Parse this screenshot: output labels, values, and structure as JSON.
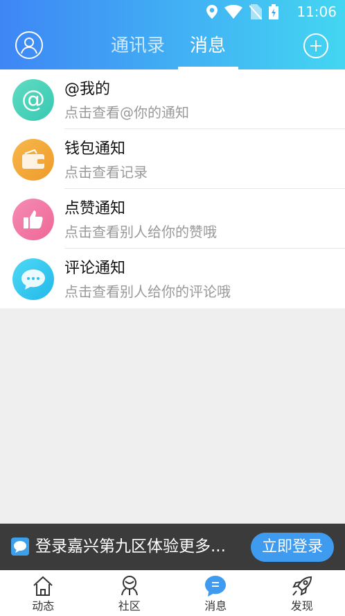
{
  "status": {
    "time": "11:06"
  },
  "header": {
    "tabs": [
      {
        "label": "通讯录",
        "active": false
      },
      {
        "label": "消息",
        "active": true
      }
    ]
  },
  "list": [
    {
      "title": "@我的",
      "subtitle": "点击查看@你的通知",
      "icon": "at-icon",
      "color": "#4ed3b8"
    },
    {
      "title": "钱包通知",
      "subtitle": "点击查看记录",
      "icon": "wallet-icon",
      "color": "#f3a93a"
    },
    {
      "title": "点赞通知",
      "subtitle": "点击查看别人给你的赞哦",
      "icon": "thumbs-up-icon",
      "color": "#f27aa8"
    },
    {
      "title": "评论通知",
      "subtitle": "点击查看别人给你的评论哦",
      "icon": "comment-icon",
      "color": "#36c8ef"
    }
  ],
  "banner": {
    "text": "登录嘉兴第九区体验更多...",
    "button": "立即登录"
  },
  "tabbar": [
    {
      "label": "动态",
      "icon": "home-icon"
    },
    {
      "label": "社区",
      "icon": "community-icon"
    },
    {
      "label": "消息",
      "icon": "message-icon",
      "active": true
    },
    {
      "label": "发现",
      "icon": "rocket-icon"
    }
  ],
  "colors": {
    "accent": "#3e9bf0",
    "header_start": "#3e86f5",
    "header_end": "#43d6f1"
  }
}
